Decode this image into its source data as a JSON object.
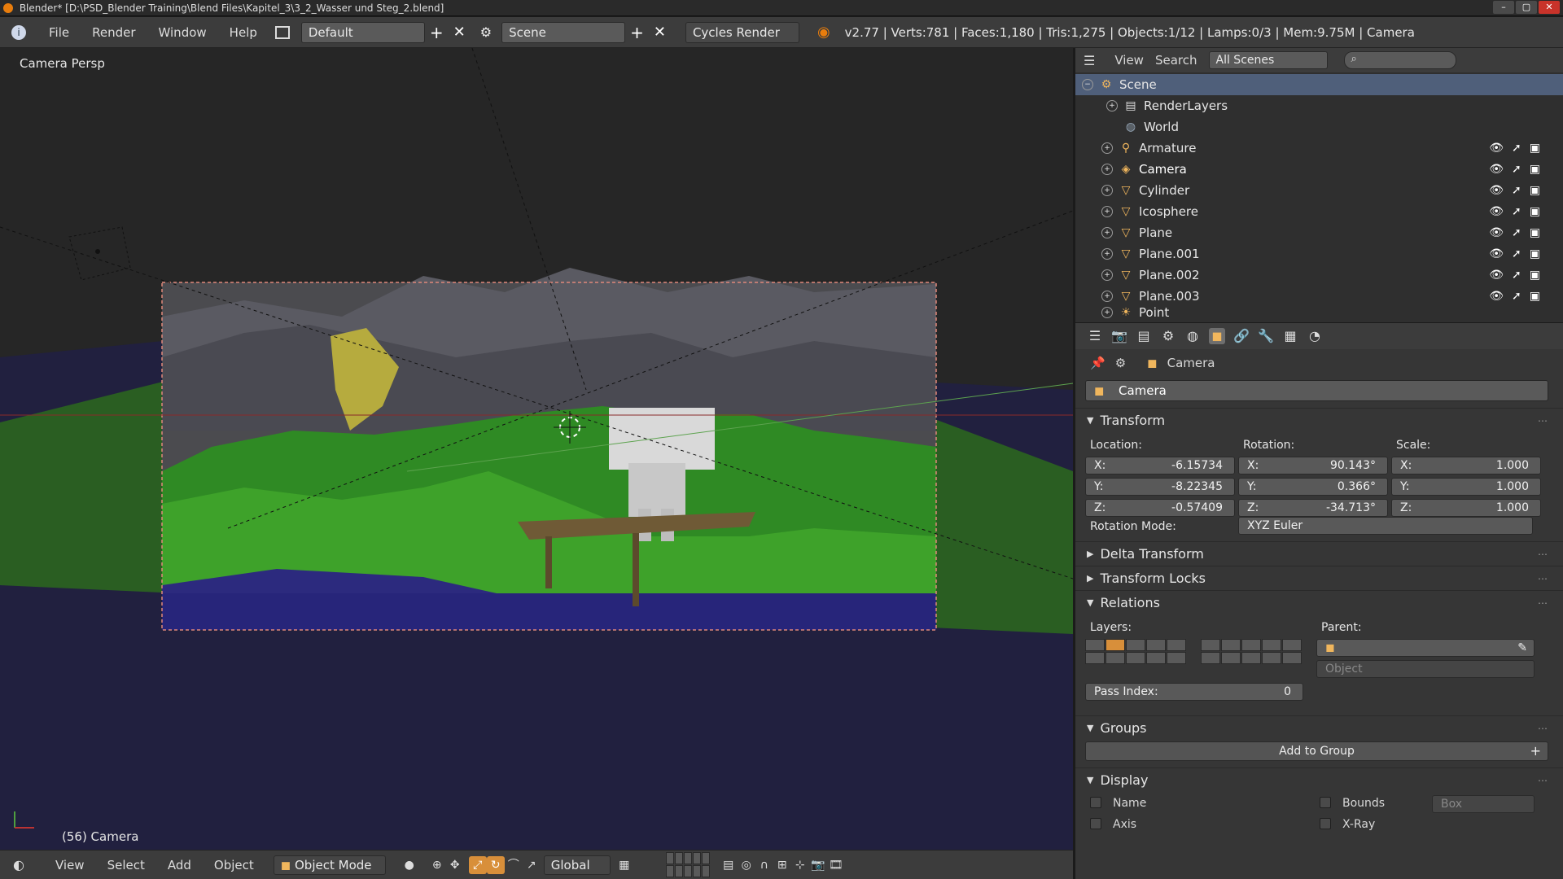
{
  "window": {
    "title": "Blender* [D:\\PSD_Blender Training\\Blend Files\\Kapitel_3\\3_2_Wasser und Steg_2.blend]"
  },
  "header": {
    "menus": [
      "File",
      "Render",
      "Window",
      "Help"
    ],
    "layout": "Default",
    "scene": "Scene",
    "engine": "Cycles Render",
    "stats": "v2.77 | Verts:781 | Faces:1,180 | Tris:1,275 | Objects:1/12 | Lamps:0/3 | Mem:9.75M | Camera"
  },
  "viewport": {
    "label": "Camera Persp",
    "frame_label": "(56) Camera"
  },
  "outliner": {
    "menus": [
      "View",
      "Search"
    ],
    "filter": "All Scenes",
    "rows": [
      {
        "label": "Scene",
        "icon": "scene-icon"
      },
      {
        "label": "RenderLayers",
        "icon": "renderlayers-icon"
      },
      {
        "label": "World",
        "icon": "world-icon"
      },
      {
        "label": "Armature",
        "icon": "armature-icon"
      },
      {
        "label": "Camera",
        "icon": "camera-icon"
      },
      {
        "label": "Cylinder",
        "icon": "mesh-icon"
      },
      {
        "label": "Icosphere",
        "icon": "mesh-icon"
      },
      {
        "label": "Plane",
        "icon": "mesh-icon"
      },
      {
        "label": "Plane.001",
        "icon": "mesh-icon"
      },
      {
        "label": "Plane.002",
        "icon": "mesh-icon"
      },
      {
        "label": "Plane.003",
        "icon": "mesh-icon"
      },
      {
        "label": "Point",
        "icon": "lamp-icon"
      }
    ]
  },
  "properties": {
    "context": "Camera",
    "object_name": "Camera",
    "transform": {
      "title": "Transform",
      "location_label": "Location:",
      "rotation_label": "Rotation:",
      "scale_label": "Scale:",
      "location": {
        "x": "-6.15734",
        "y": "-8.22345",
        "z": "-0.57409"
      },
      "rotation": {
        "x": "90.143°",
        "y": "0.366°",
        "z": "-34.713°"
      },
      "scale": {
        "x": "1.000",
        "y": "1.000",
        "z": "1.000"
      },
      "axis_x": "X:",
      "axis_y": "Y:",
      "axis_z": "Z:",
      "rotation_mode_label": "Rotation Mode:",
      "rotation_mode": "XYZ Euler"
    },
    "delta_transform": "Delta Transform",
    "transform_locks": "Transform Locks",
    "relations": {
      "title": "Relations",
      "layers_label": "Layers:",
      "parent_label": "Parent:",
      "parent_type": "Object",
      "pass_index_label": "Pass Index:",
      "pass_index": "0"
    },
    "groups": {
      "title": "Groups",
      "add_button": "Add to Group"
    },
    "display": {
      "title": "Display",
      "name_label": "Name",
      "bounds_label": "Bounds",
      "bounds_type": "Box",
      "axis_label": "Axis",
      "xray_label": "X-Ray"
    }
  },
  "bottombar": {
    "menus": [
      "View",
      "Select",
      "Add",
      "Object"
    ],
    "mode": "Object Mode",
    "orientation": "Global"
  }
}
